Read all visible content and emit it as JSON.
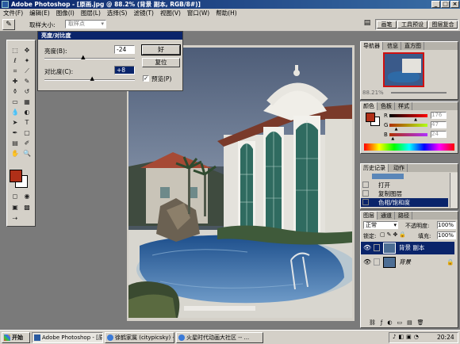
{
  "window": {
    "title": "Adobe Photoshop - [原画.jpg @ 88.2% (背景 副本, RGB/8#)]"
  },
  "menu": [
    "文件(F)",
    "编辑(E)",
    "图像(I)",
    "图层(L)",
    "选择(S)",
    "滤镜(T)",
    "视图(V)",
    "窗口(W)",
    "帮助(H)"
  ],
  "options": {
    "sample_label": "取样大小:",
    "sample_value": "取样点"
  },
  "panel_tabs_top": [
    "画笔",
    "工具预设",
    "图层复合"
  ],
  "dialog": {
    "title": "亮度/对比度",
    "brightness_label": "亮度(B):",
    "brightness_value": "-24",
    "brightness_level": 0.44,
    "contrast_label": "对比度(C):",
    "contrast_value": "+8",
    "contrast_level": 0.54,
    "ok_label": "好",
    "reset_label": "复位",
    "preview_label": "预览(P)"
  },
  "navigator": {
    "tabs": [
      "导航器",
      "信息",
      "直方图"
    ],
    "zoom": "88.21%"
  },
  "color_panel": {
    "tabs": [
      "颜色",
      "色板",
      "样式"
    ],
    "channels": [
      {
        "label": "R",
        "value": "176",
        "level": 0.69
      },
      {
        "label": "G",
        "value": "47",
        "level": 0.18
      },
      {
        "label": "B",
        "value": "24",
        "level": 0.09
      }
    ],
    "fg_color": "#b02f18"
  },
  "history": {
    "tabs": [
      "历史记录",
      "动作"
    ],
    "items": [
      "打开",
      "复制图层",
      "色相/饱和度"
    ]
  },
  "layers": {
    "tabs": [
      "图层",
      "通道",
      "路径"
    ],
    "blend_mode": "正常",
    "opacity_label": "不透明度:",
    "opacity_value": "100%",
    "lock_label": "锁定:",
    "fill_label": "填充:",
    "fill_value": "100%",
    "items": [
      {
        "name": "背景 副本",
        "selected": true
      },
      {
        "name": "背景",
        "selected": false
      }
    ]
  },
  "taskbar": {
    "start_label": "开始",
    "items": [
      "Adobe Photoshop - [原画...",
      "徐鹤家属 (citypicsky) -- ...",
      "火星时代动画大社区 -- ..."
    ],
    "clock": "20:24"
  }
}
